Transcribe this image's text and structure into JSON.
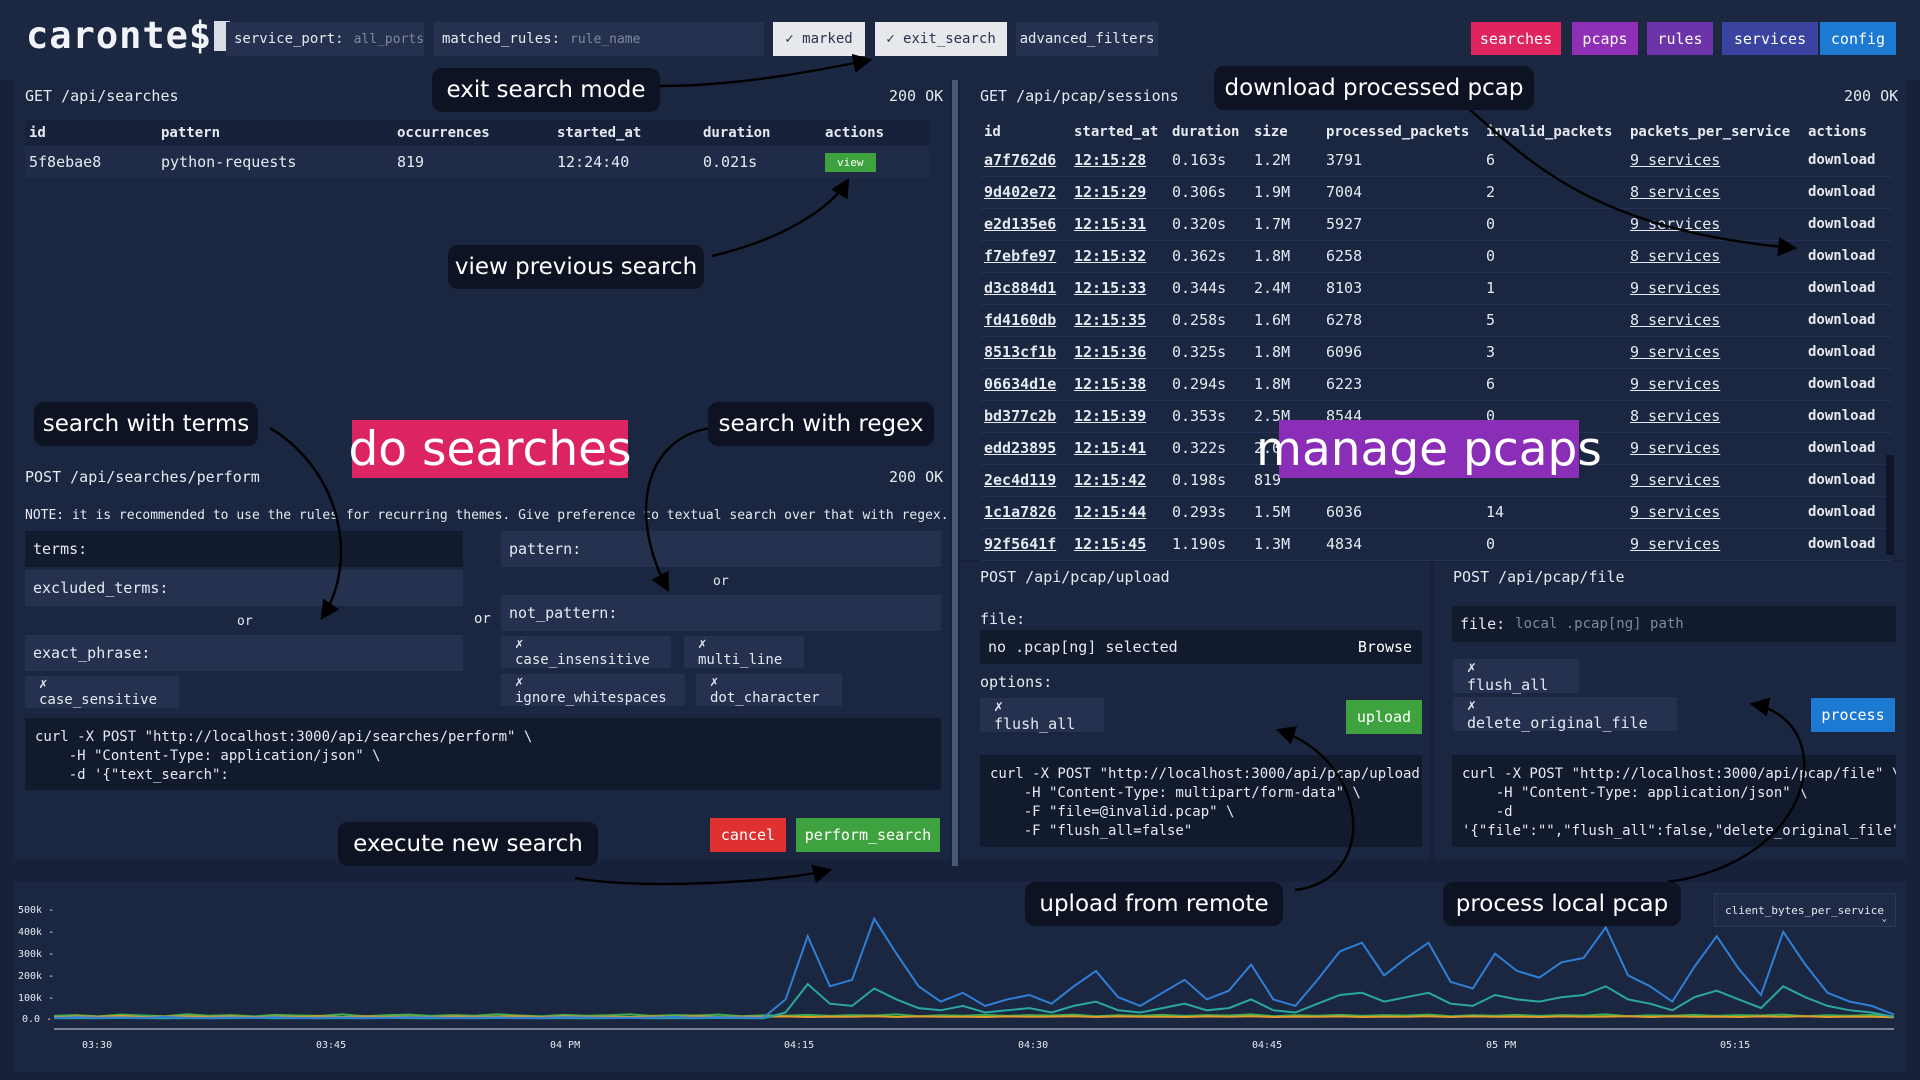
{
  "header": {
    "logo": "caronte$",
    "service_port_label": "service_port:",
    "service_port_placeholder": "all_ports",
    "matched_rules_label": "matched_rules:",
    "matched_rules_placeholder": "rule_name",
    "marked_label": "✓ marked",
    "exit_search_label": "✓ exit_search",
    "advanced_filters_label": "advanced_filters",
    "nav": [
      {
        "label": "searches",
        "color": "#e0255e"
      },
      {
        "label": "pcaps",
        "color": "#8e2fb5"
      },
      {
        "label": "rules",
        "color": "#6d33a8"
      },
      {
        "label": "services",
        "color": "#3a44a0"
      },
      {
        "label": "config",
        "color": "#1d7ad2"
      }
    ]
  },
  "searches_panel": {
    "title": "GET /api/searches",
    "status": "200 OK",
    "columns": [
      "id",
      "pattern",
      "occurrences",
      "started_at",
      "duration",
      "actions"
    ],
    "row": {
      "id": "5f8ebae8",
      "pattern": "python-requests",
      "occurrences": "819",
      "started_at": "12:24:40",
      "duration": "0.021s",
      "action": "view"
    }
  },
  "perform_panel": {
    "title": "POST /api/searches/perform",
    "status": "200 OK",
    "note": "NOTE: it is recommended to use the rules for recurring themes. Give preference to textual search over that with regex.",
    "terms_label": "terms:",
    "excluded_terms_label": "excluded_terms:",
    "or1": "or",
    "exact_phrase_label": "exact_phrase:",
    "case_sensitive": "✗ case_sensitive",
    "or_mid": "or",
    "pattern_label": "pattern:",
    "or2": "or",
    "not_pattern_label": "not_pattern:",
    "case_insensitive": "✗ case_insensitive",
    "multi_line": "✗ multi_line",
    "ignore_whitespaces": "✗ ignore_whitespaces",
    "dot_character": "✗ dot_character",
    "curl": "curl -X POST \"http://localhost:3000/api/searches/perform\" \\\n    -H \"Content-Type: application/json\" \\\n    -d '{\"text_search\":",
    "cancel_label": "cancel",
    "perform_label": "perform_search"
  },
  "sessions_panel": {
    "title": "GET /api/pcap/sessions",
    "status": "200 OK",
    "columns": [
      "id",
      "started_at",
      "duration",
      "size",
      "processed_packets",
      "invalid_packets",
      "packets_per_service",
      "actions"
    ],
    "rows": [
      {
        "id": "a7f762d6",
        "started_at": "12:15:28",
        "duration": "0.163s",
        "size": "1.2M",
        "processed": "3791",
        "invalid": "6",
        "services": "9 services",
        "action": "download"
      },
      {
        "id": "9d402e72",
        "started_at": "12:15:29",
        "duration": "0.306s",
        "size": "1.9M",
        "processed": "7004",
        "invalid": "2",
        "services": "8 services",
        "action": "download"
      },
      {
        "id": "e2d135e6",
        "started_at": "12:15:31",
        "duration": "0.320s",
        "size": "1.7M",
        "processed": "5927",
        "invalid": "0",
        "services": "9 services",
        "action": "download"
      },
      {
        "id": "f7ebfe97",
        "started_at": "12:15:32",
        "duration": "0.362s",
        "size": "1.8M",
        "processed": "6258",
        "invalid": "0",
        "services": "8 services",
        "action": "download"
      },
      {
        "id": "d3c884d1",
        "started_at": "12:15:33",
        "duration": "0.344s",
        "size": "2.4M",
        "processed": "8103",
        "invalid": "1",
        "services": "9 services",
        "action": "download"
      },
      {
        "id": "fd4160db",
        "started_at": "12:15:35",
        "duration": "0.258s",
        "size": "1.6M",
        "processed": "6278",
        "invalid": "5",
        "services": "8 services",
        "action": "download"
      },
      {
        "id": "8513cf1b",
        "started_at": "12:15:36",
        "duration": "0.325s",
        "size": "1.8M",
        "processed": "6096",
        "invalid": "3",
        "services": "9 services",
        "action": "download"
      },
      {
        "id": "06634d1e",
        "started_at": "12:15:38",
        "duration": "0.294s",
        "size": "1.8M",
        "processed": "6223",
        "invalid": "6",
        "services": "9 services",
        "action": "download"
      },
      {
        "id": "bd377c2b",
        "started_at": "12:15:39",
        "duration": "0.353s",
        "size": "2.5M",
        "processed": "8544",
        "invalid": "0",
        "services": "8 services",
        "action": "download"
      },
      {
        "id": "edd23895",
        "started_at": "12:15:41",
        "duration": "0.322s",
        "size": "2.0",
        "processed": "",
        "invalid": "",
        "services": "9 services",
        "action": "download"
      },
      {
        "id": "2ec4d119",
        "started_at": "12:15:42",
        "duration": "0.198s",
        "size": "819",
        "processed": "",
        "invalid": "",
        "services": "9 services",
        "action": "download"
      },
      {
        "id": "1c1a7826",
        "started_at": "12:15:44",
        "duration": "0.293s",
        "size": "1.5M",
        "processed": "6036",
        "invalid": "14",
        "services": "9 services",
        "action": "download"
      },
      {
        "id": "92f5641f",
        "started_at": "12:15:45",
        "duration": "1.190s",
        "size": "1.3M",
        "processed": "4834",
        "invalid": "0",
        "services": "9 services",
        "action": "download"
      }
    ]
  },
  "upload_panel": {
    "title": "POST /api/pcap/upload",
    "file_label": "file:",
    "file_value": "no .pcap[ng] selected",
    "browse_label": "Browse",
    "options_label": "options:",
    "flush_all": "✗ flush_all",
    "upload_label": "upload",
    "curl": "curl -X POST \"http://localhost:3000/api/pcap/upload\" \\\n    -H \"Content-Type: multipart/form-data\" \\\n    -F \"file=@invalid.pcap\" \\\n    -F \"flush_all=false\""
  },
  "file_panel": {
    "title": "POST /api/pcap/file",
    "file_label": "file:",
    "file_placeholder": "local .pcap[ng] path",
    "flush_all": "✗ flush_all",
    "delete_original": "✗ delete_original_file",
    "process_label": "process",
    "curl": "curl -X POST \"http://localhost:3000/api/pcap/file\" \\\n    -H \"Content-Type: application/json\" \\\n    -d\n'{\"file\":\"\",\"flush_all\":false,\"delete_original_file\":"
  },
  "annotations": {
    "exit_search": "exit search mode",
    "view_previous": "view previous search",
    "search_terms": "search with terms",
    "search_regex": "search with regex",
    "do_searches": "do searches",
    "execute_new": "execute new search",
    "download_pcap": "download processed pcap",
    "manage_pcaps": "manage pcaps",
    "upload_remote": "upload from remote",
    "process_local": "process local pcap"
  },
  "chart_data": {
    "type": "line",
    "y_ticks": [
      "500k -",
      "400k -",
      "300k -",
      "200k -",
      "100k -",
      "0.0 -"
    ],
    "ylim": [
      0,
      500000
    ],
    "x_ticks": [
      "03:30",
      "03:45",
      "04 PM",
      "04:15",
      "04:30",
      "04:45",
      "05 PM",
      "05:15"
    ],
    "metric_select": "client_bytes_per_service",
    "series_colors": [
      "#2f7fd6",
      "#2aa7a0",
      "#e09b2d",
      "#3ab04e"
    ],
    "series": [
      {
        "values": [
          5000,
          8000,
          6000,
          7000,
          5000,
          9000,
          6000,
          5000,
          7000,
          6000,
          8000,
          5000,
          6000,
          7000,
          5000,
          6000,
          8000,
          7000,
          5000,
          6000,
          7000,
          5000,
          6000,
          8000,
          7000,
          6000,
          5000,
          7000,
          9000,
          6000,
          8000,
          7000,
          6000,
          90000,
          380000,
          150000,
          180000,
          460000,
          300000,
          150000,
          80000,
          120000,
          60000,
          90000,
          110000,
          70000,
          150000,
          220000,
          100000,
          60000,
          120000,
          180000,
          90000,
          130000,
          250000,
          90000,
          60000,
          180000,
          310000,
          350000,
          200000,
          280000,
          350000,
          170000,
          140000,
          300000,
          220000,
          190000,
          260000,
          280000,
          420000,
          200000,
          150000,
          80000,
          240000,
          380000,
          230000,
          110000,
          400000,
          250000,
          120000,
          80000,
          60000,
          20000
        ]
      },
      {
        "values": [
          3000,
          4000,
          3000,
          5000,
          4000,
          3000,
          4000,
          3000,
          4000,
          5000,
          3000,
          4000,
          3000,
          4000,
          3000,
          5000,
          4000,
          3000,
          4000,
          3000,
          5000,
          4000,
          3000,
          4000,
          3000,
          4000,
          5000,
          3000,
          4000,
          3000,
          5000,
          4000,
          3000,
          30000,
          160000,
          70000,
          60000,
          140000,
          90000,
          50000,
          40000,
          60000,
          30000,
          40000,
          50000,
          30000,
          60000,
          80000,
          40000,
          30000,
          50000,
          70000,
          40000,
          50000,
          90000,
          40000,
          30000,
          70000,
          110000,
          120000,
          80000,
          100000,
          120000,
          70000,
          60000,
          110000,
          90000,
          80000,
          100000,
          110000,
          150000,
          90000,
          70000,
          40000,
          100000,
          130000,
          90000,
          50000,
          150000,
          100000,
          60000,
          40000,
          30000,
          10000
        ]
      },
      {
        "values": [
          8000,
          12000,
          10000,
          14000,
          9000,
          11000,
          13000,
          10000,
          12000,
          9000,
          11000,
          10000,
          13000,
          9000,
          12000,
          10000,
          11000,
          9000,
          12000,
          10000,
          11000,
          13000,
          9000,
          12000,
          10000,
          11000,
          9000,
          12000,
          10000,
          13000,
          9000,
          11000,
          10000,
          12000,
          9000,
          11000,
          10000,
          13000,
          9000,
          12000,
          10000,
          11000,
          9000,
          12000,
          10000,
          11000,
          13000,
          9000,
          12000,
          10000,
          11000,
          9000,
          12000,
          10000,
          13000,
          9000,
          11000,
          10000,
          12000,
          9000,
          11000,
          10000,
          13000,
          9000,
          12000,
          10000,
          11000,
          9000,
          12000,
          10000,
          11000,
          13000,
          9000,
          12000,
          10000,
          11000,
          9000,
          12000,
          10000,
          13000,
          9000,
          11000,
          10000,
          8000
        ]
      },
      {
        "values": [
          14000,
          18000,
          12000,
          20000,
          16000,
          13000,
          22000,
          15000,
          18000,
          12000,
          19000,
          16000,
          14000,
          21000,
          13000,
          17000,
          20000,
          14000,
          18000,
          15000,
          22000,
          16000,
          13000,
          19000,
          15000,
          17000,
          21000,
          14000,
          18000,
          16000,
          20000,
          13000,
          17000,
          15000,
          19000,
          14000,
          18000,
          16000,
          21000,
          13000,
          17000,
          15000,
          19000,
          14000,
          18000,
          16000,
          20000,
          13000,
          17000,
          15000,
          19000,
          14000,
          18000,
          16000,
          21000,
          13000,
          17000,
          15000,
          19000,
          14000,
          18000,
          16000,
          20000,
          13000,
          17000,
          15000,
          19000,
          14000,
          18000,
          16000,
          21000,
          13000,
          17000,
          15000,
          19000,
          14000,
          18000,
          16000,
          20000,
          13000,
          17000,
          15000,
          19000,
          12000
        ]
      }
    ]
  }
}
